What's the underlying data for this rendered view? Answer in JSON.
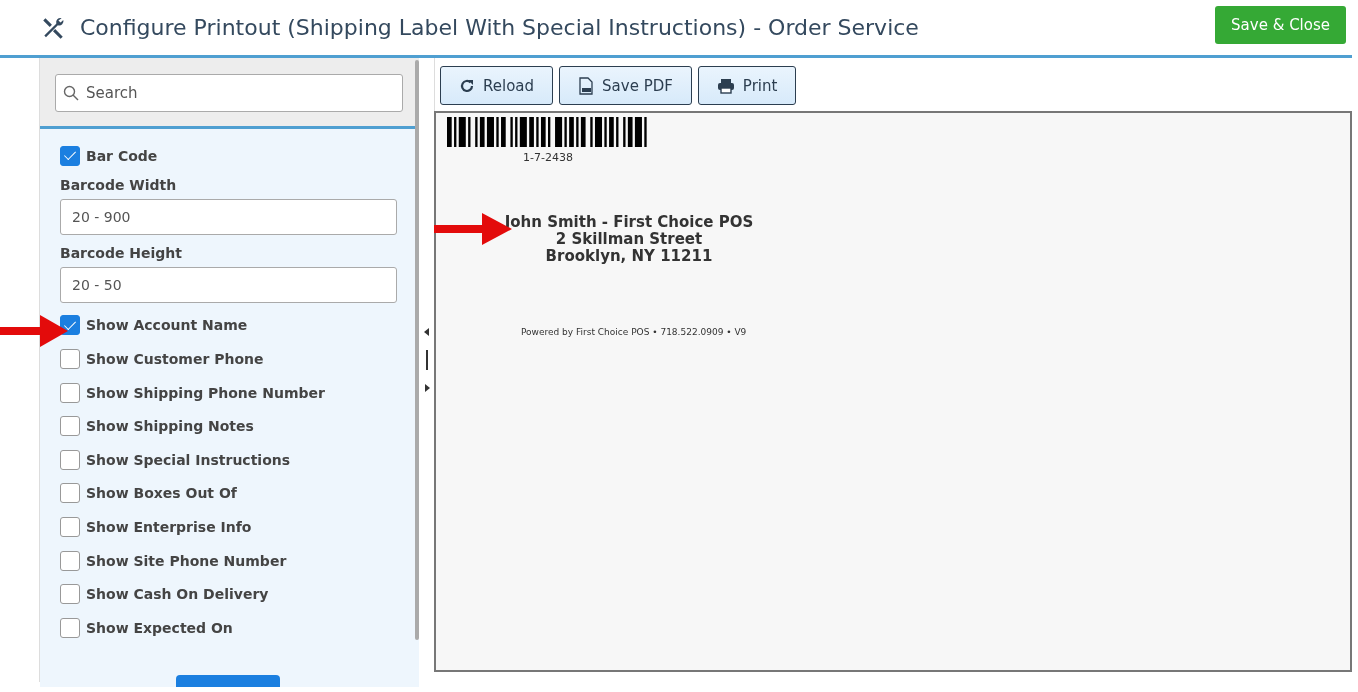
{
  "header": {
    "title": "Configure Printout (Shipping Label With Special Instructions) - Order Service",
    "save_button": "Save & Close"
  },
  "sidebar": {
    "search": {
      "placeholder": "Search"
    },
    "items": [
      {
        "kind": "checkbox",
        "label": "Bar Code",
        "checked": true
      },
      {
        "kind": "field",
        "label": "Barcode Width",
        "placeholder": "20 - 900"
      },
      {
        "kind": "field",
        "label": "Barcode Height",
        "placeholder": "20 - 50"
      },
      {
        "kind": "checkbox",
        "label": "Show Account Name",
        "checked": true
      },
      {
        "kind": "checkbox",
        "label": "Show Customer Phone",
        "checked": false
      },
      {
        "kind": "checkbox",
        "label": "Show Shipping Phone Number",
        "checked": false
      },
      {
        "kind": "checkbox",
        "label": "Show Shipping Notes",
        "checked": false
      },
      {
        "kind": "checkbox",
        "label": "Show Special Instructions",
        "checked": false
      },
      {
        "kind": "checkbox",
        "label": "Show Boxes Out Of",
        "checked": false
      },
      {
        "kind": "checkbox",
        "label": "Show Enterprise Info",
        "checked": false
      },
      {
        "kind": "checkbox",
        "label": "Show Site Phone Number",
        "checked": false
      },
      {
        "kind": "checkbox",
        "label": "Show Cash On Delivery",
        "checked": false
      },
      {
        "kind": "checkbox",
        "label": "Show Expected On",
        "checked": false
      }
    ]
  },
  "toolbar": [
    {
      "kind": "reload",
      "label": "Reload"
    },
    {
      "kind": "pdf",
      "label": "Save PDF"
    },
    {
      "kind": "print",
      "label": "Print"
    }
  ],
  "preview": {
    "barcode_text": "1-7-2438",
    "address_lines": [
      "John Smith - First Choice POS",
      "2 Skillman Street",
      "Brooklyn, NY 11211"
    ],
    "footer": "Powered by First Choice POS • 718.522.0909 • V9"
  }
}
